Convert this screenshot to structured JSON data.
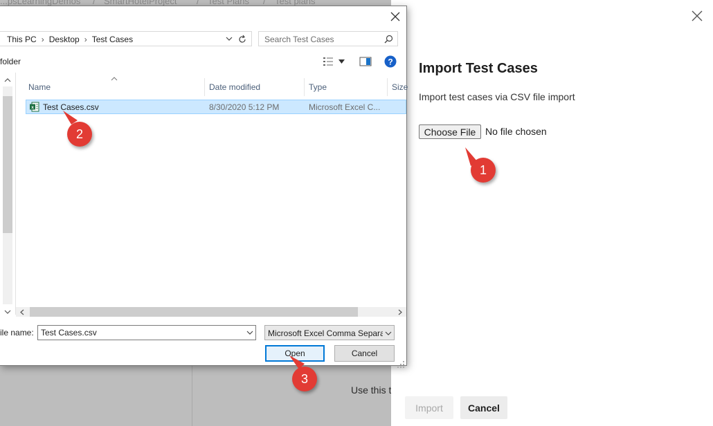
{
  "background": {
    "breadcrumb": [
      "...psLearningDemos",
      "/",
      "SmartHotelProject",
      "/",
      "Test Plans",
      "/",
      "Test plans"
    ],
    "hint_text": "Use this t"
  },
  "panel": {
    "title": "Import Test Cases",
    "description": "Import test cases via CSV file import",
    "choose_file_label": "Choose File",
    "no_file_text": "No file chosen",
    "import_label": "Import",
    "cancel_label": "Cancel"
  },
  "dialog": {
    "address": {
      "segments": [
        "This PC",
        "Desktop",
        "Test Cases"
      ]
    },
    "search_placeholder": "Search Test Cases",
    "toolbar": {
      "new_folder_fragment": "folder"
    },
    "columns": {
      "name": "Name",
      "date_modified": "Date modified",
      "type": "Type",
      "size": "Size"
    },
    "files": [
      {
        "name": "Test Cases.csv",
        "date_modified": "8/30/2020 5:12 PM",
        "type": "Microsoft Excel C..."
      }
    ],
    "file_name_label": "ile name:",
    "file_name_value": "Test Cases.csv",
    "file_type_selected": "Microsoft Excel Comma Separated",
    "open_label": "Open",
    "cancel_label": "Cancel"
  },
  "callouts": [
    "1",
    "2",
    "3"
  ],
  "colors": {
    "accent": "#0078d7",
    "selection": "#cce8ff",
    "callout": "#e23b34",
    "excel_green": "#1d6f42"
  }
}
